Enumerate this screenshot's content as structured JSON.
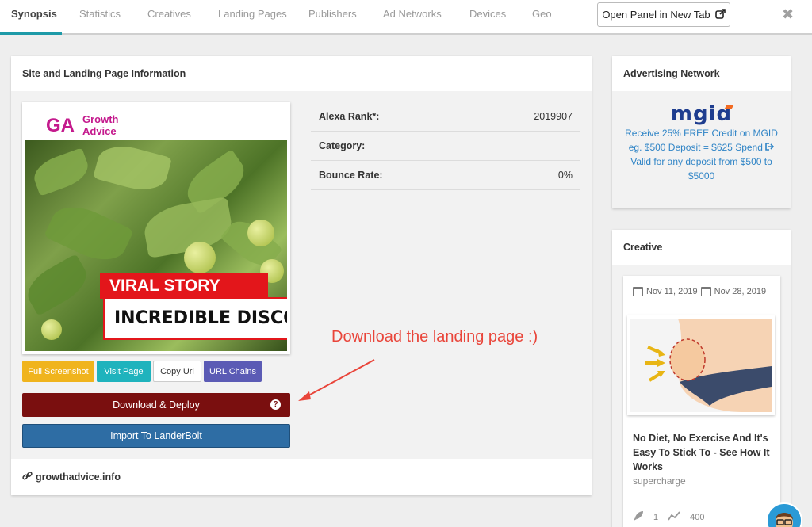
{
  "tabs": [
    {
      "label": "Synopsis",
      "active": true
    },
    {
      "label": "Statistics"
    },
    {
      "label": "Creatives"
    },
    {
      "label": "Landing Pages"
    },
    {
      "label": "Publishers"
    },
    {
      "label": "Ad Networks"
    },
    {
      "label": "Devices"
    },
    {
      "label": "Geo"
    }
  ],
  "open_panel_label": "Open Panel in New Tab",
  "close_label": "✖",
  "site_card": {
    "title": "Site and Landing Page Information",
    "preview": {
      "logo_letters": "GA",
      "logo_line1": "Growth",
      "logo_line2": "Advice",
      "banner_top": "VIRAL STORY",
      "banner_bottom": "INCREDIBLE DISCO"
    },
    "buttons": {
      "full_screenshot": "Full Screenshot",
      "visit_page": "Visit Page",
      "copy_url": "Copy Url",
      "url_chains": "URL Chains",
      "download_deploy": "Download & Deploy",
      "import": "Import To LanderBolt"
    },
    "stats": [
      {
        "label": "Alexa Rank*:",
        "value": "2019907"
      },
      {
        "label": "Category:",
        "value": ""
      },
      {
        "label": "Bounce Rate:",
        "value": "0%"
      }
    ],
    "domain": "growthadvice.info"
  },
  "annotation": "Download the landing page :)",
  "ad_network": {
    "title": "Advertising Network",
    "logo": "mgid",
    "line1": "Receive 25% FREE Credit on MGID",
    "line2": "eg. $500 Deposit = $625 Spend",
    "line3": "Valid for any deposit from $500 to $5000"
  },
  "creative": {
    "title": "Creative",
    "date_start": "Nov 11, 2019",
    "date_end": "Nov 28, 2019",
    "headline": "No Diet, No Exercise And It's Easy To Stick To - See How It Works",
    "source": "supercharge",
    "stat_1": "1",
    "stat_2": "400"
  },
  "colors": {
    "accent": "#1e9aa8",
    "full_screenshot": "#f0b41d",
    "visit_page": "#1fb3bd",
    "url_chains": "#5b5bb5",
    "download": "#7a0f0f",
    "import": "#2e6da4",
    "annotation": "#e9453a"
  }
}
